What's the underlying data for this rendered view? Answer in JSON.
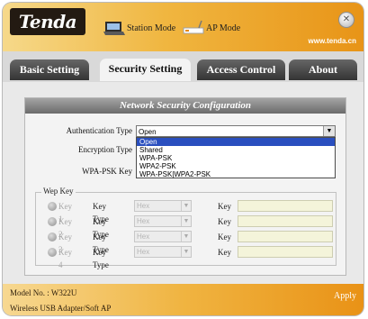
{
  "app": {
    "logo": "Tenda",
    "url": "www.tenda.cn",
    "modes": [
      "Station Mode",
      "AP Mode"
    ]
  },
  "tabs": [
    "Basic Setting",
    "Security Setting",
    "Access Control",
    "About"
  ],
  "active_tab": "Security Setting",
  "panel": {
    "title": "Network Security Configuration",
    "auth_label": "Authentication Type",
    "auth_value": "Open",
    "auth_options": [
      "Open",
      "Shared",
      "WPA-PSK",
      "WPA2-PSK",
      "WPA-PSK|WPA2-PSK"
    ],
    "enc_label": "Encryption Type",
    "wpa_label": "WPA-PSK Key",
    "wep_legend": "Wep Key",
    "wep_rows": [
      {
        "key": "Key 1",
        "key_type_label": "Key Type",
        "type_value": "Hex",
        "key_label": "Key"
      },
      {
        "key": "Key 2",
        "key_type_label": "Key Type",
        "type_value": "Hex",
        "key_label": "Key"
      },
      {
        "key": "Key 3",
        "key_type_label": "Key Type",
        "type_value": "Hex",
        "key_label": "Key"
      },
      {
        "key": "Key 4",
        "key_type_label": "Key Type",
        "type_value": "Hex",
        "key_label": "Key"
      }
    ]
  },
  "footer": {
    "model": "Model No. : W322U",
    "apply": "Apply",
    "product": "Wireless USB Adapter/Soft AP"
  },
  "colors": {
    "accent": "#f0b640",
    "selection": "#2a4fbf"
  }
}
